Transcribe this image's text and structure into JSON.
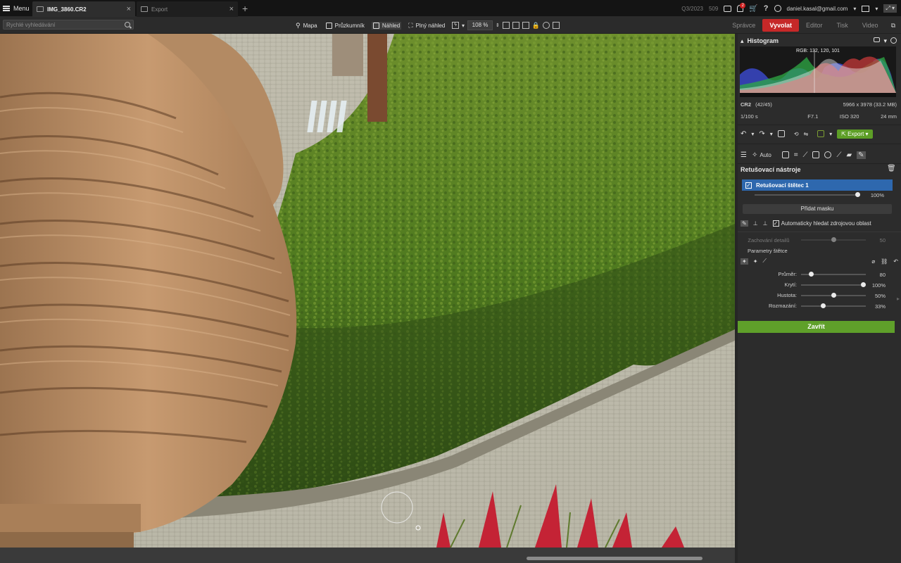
{
  "titlebar": {
    "menu_label": "Menu",
    "tabs": [
      {
        "label": "IMG_3860.CR2",
        "active": true
      },
      {
        "label": "Export",
        "active": false
      }
    ],
    "new_tab": "+",
    "period": "Q3/2023",
    "count": "509",
    "notification_count": "2",
    "help": "?",
    "user_email": "daniel.kasal@gmail.com"
  },
  "toolbar": {
    "search_placeholder": "Rychlé vyhledávání",
    "views": [
      {
        "label": "Mapa",
        "icon": "map-pin-icon"
      },
      {
        "label": "Průzkumník",
        "icon": "folder-icon"
      },
      {
        "label": "Náhled",
        "icon": "image-icon",
        "selected": true
      },
      {
        "label": "Plný náhled",
        "icon": "fullscreen-icon"
      }
    ],
    "zoom": "108 %",
    "modes": [
      {
        "label": "Správce",
        "active": false
      },
      {
        "label": "Vyvolat",
        "active": true
      },
      {
        "label": "Editor",
        "active": false
      },
      {
        "label": "Tisk",
        "active": false
      },
      {
        "label": "Video",
        "active": false
      }
    ]
  },
  "panel": {
    "histogram": {
      "title": "Histogram",
      "rgb_readout": "RGB: 132, 120, 101"
    },
    "file_info": {
      "format": "CR2",
      "index": "(42/45)",
      "dimensions": "5966 x 3978 (33.2 MB)",
      "shutter": "1/100 s",
      "aperture": "F7.1",
      "iso": "ISO 320",
      "focal": "24 mm"
    },
    "export_label": "Export",
    "tools_auto": "Auto",
    "retouch": {
      "title": "Retušovací nástroje",
      "brush_name": "Retušovací štětec 1",
      "brush_opacity_value": "100%",
      "brush_opacity": 1.0,
      "add_mask": "Přidat masku",
      "auto_find_label": "Automaticky hledat zdrojovou oblast",
      "detail_label": "Zachování detailů",
      "detail_value": "50",
      "detail_level": 0.5,
      "params_title": "Parametry štětce",
      "sliders": [
        {
          "label": "Průměr:",
          "value": "80",
          "level": 0.13
        },
        {
          "label": "Krytí:",
          "value": "100%",
          "level": 1.0
        },
        {
          "label": "Hustota:",
          "value": "50%",
          "level": 0.5
        },
        {
          "label": "Rozmazání:",
          "value": "33%",
          "level": 0.33
        }
      ],
      "close_label": "Zavřít"
    }
  },
  "colors": {
    "accent_red": "#c62828",
    "accent_green": "#5fa02a",
    "selection_blue": "#2e68ae"
  }
}
